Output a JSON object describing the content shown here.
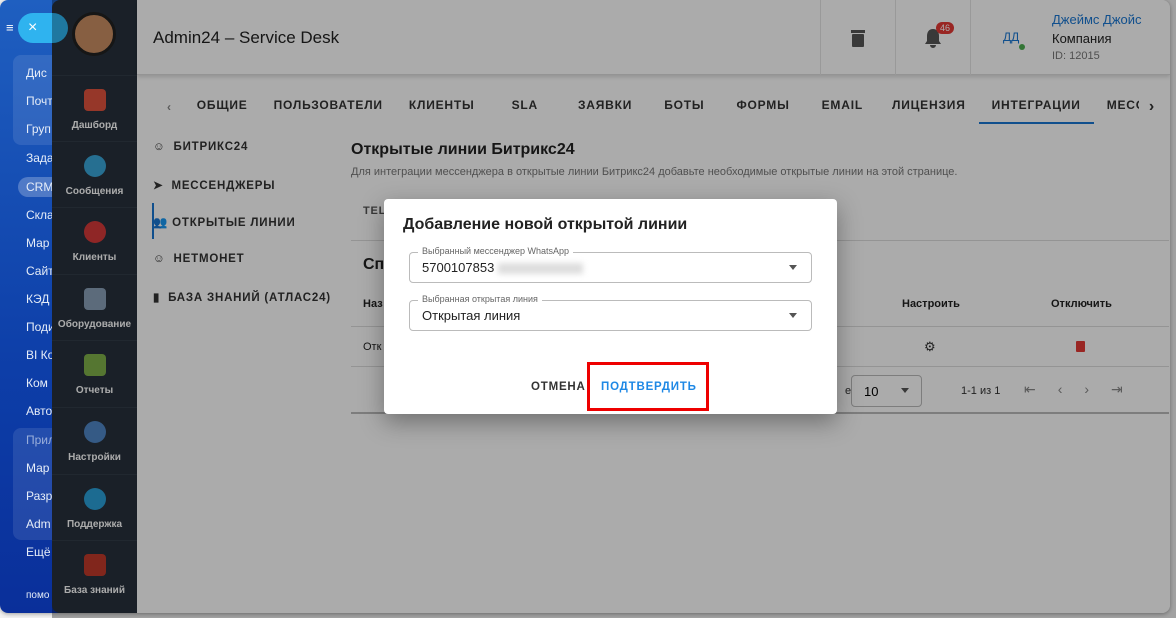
{
  "left_nav": {
    "items": [
      "Дис",
      "Почт",
      "Груп",
      "Зада",
      "CRM",
      "Скла",
      "Мар",
      "Сайт",
      "КЭД",
      "Поди",
      "BI Ко",
      "Ком",
      "Авто",
      "Прил",
      "Мар",
      "Разр",
      "Adm",
      "Ещё",
      "помо"
    ],
    "close": "×",
    "menu": "≡"
  },
  "sidebar": {
    "items": [
      {
        "label": "Дашборд",
        "icon": "dashboard-icon",
        "color": "#e0533e"
      },
      {
        "label": "Сообщения",
        "icon": "chat-icon",
        "color": "#3aa6d8"
      },
      {
        "label": "Клиенты",
        "icon": "clients-icon",
        "color": "#d63a3a"
      },
      {
        "label": "Оборудование",
        "icon": "equipment-icon",
        "color": "#8aa0b8"
      },
      {
        "label": "Отчеты",
        "icon": "reports-icon",
        "color": "#7fb04a"
      },
      {
        "label": "Настройки",
        "icon": "gear-icon",
        "color": "#4f86c6"
      },
      {
        "label": "Поддержка",
        "icon": "help-icon",
        "color": "#2aa0d8"
      },
      {
        "label": "База знаний",
        "icon": "book-icon",
        "color": "#c0392b"
      }
    ]
  },
  "header": {
    "title": "Admin24 – Service Desk",
    "notifications": "46",
    "user_initials": "ДД",
    "user_name": "Джеймс Джойс",
    "company": "Компания",
    "user_id": "ID: 12015"
  },
  "tabs": [
    "ОБЩИЕ",
    "ПОЛЬЗОВАТЕЛИ",
    "КЛИЕНТЫ",
    "SLA",
    "ЗАЯВКИ",
    "БОТЫ",
    "ФОРМЫ",
    "EMAIL",
    "ЛИЦЕНЗИЯ",
    "ИНТЕГРАЦИИ",
    "МЕССЕНДЖЕ"
  ],
  "subnav": [
    "БИТРИКС24",
    "МЕССЕНДЖЕРЫ",
    "ОТКРЫТЫЕ ЛИНИИ",
    "НЕТМОНЕТ",
    "БАЗА ЗНАНИЙ (АТЛАС24)"
  ],
  "content": {
    "title": "Открытые линии Битрикс24",
    "description": "Для интеграции мессенджера в открытые линии Битрикс24 добавьте необходимые открытые линии на этой странице.",
    "tab_fragment": "TEL",
    "list_fragment": "Сп",
    "col_name": "Наз",
    "col_configure": "Настроить",
    "col_disable": "Отключить",
    "row_name": "Отк",
    "per_page_fragment": "е",
    "per_page": "10",
    "range": "1-1 из 1"
  },
  "modal": {
    "title": "Добавление новой открытой линии",
    "messenger_label": "Выбранный мессенджер WhatsApp",
    "messenger_value": "5700107853",
    "line_label": "Выбранная открытая линия",
    "line_value": "Открытая линия",
    "cancel": "ОТМЕНА",
    "confirm": "ПОДТВЕРДИТЬ"
  },
  "colors": {
    "accent": "#1976d2",
    "highlight": "#e00000"
  }
}
